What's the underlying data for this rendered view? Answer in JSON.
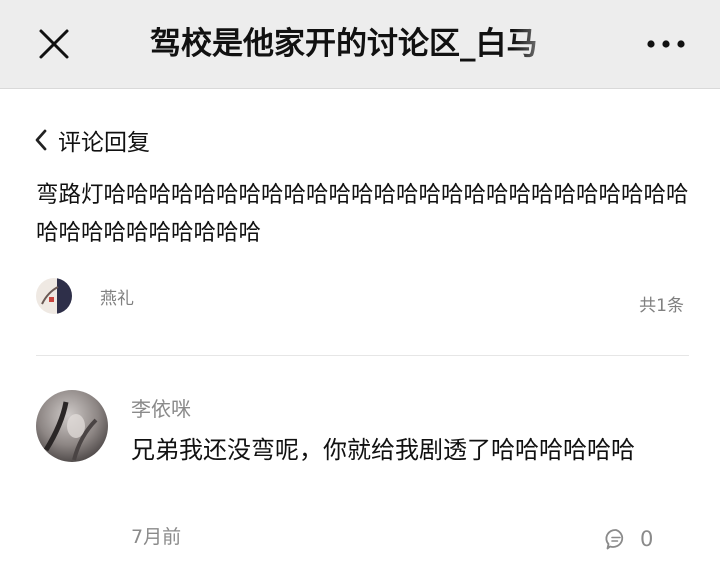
{
  "topbar": {
    "title": "驾校是他家开的讨论区_白马",
    "close_icon": "close-icon",
    "more_icon": "more-dots-icon"
  },
  "back": {
    "label": "评论回复",
    "icon": "chevron-left-icon"
  },
  "main_comment": {
    "text": "弯路灯哈哈哈哈哈哈哈哈哈哈哈哈哈哈哈哈哈哈哈哈哈哈哈哈哈哈哈哈哈哈哈哈哈哈哈哈",
    "author": "燕礼",
    "reply_count": "共1条"
  },
  "replies": [
    {
      "name": "李依咪",
      "text": "兄弟我还没弯呢，你就给我剧透了哈哈哈哈哈哈",
      "time": "7月前",
      "likes": "0"
    }
  ],
  "colors": {
    "topbar_bg": "#ededed",
    "meta_text": "#808080"
  }
}
